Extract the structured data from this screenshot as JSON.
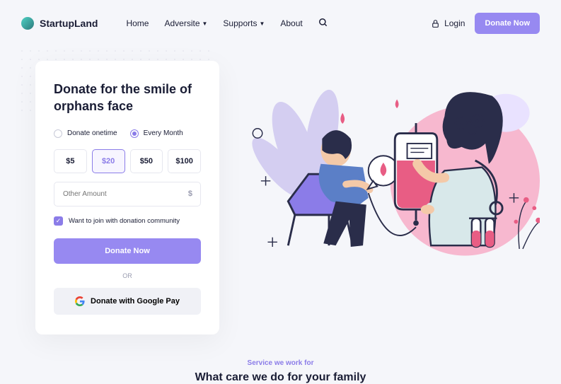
{
  "brand": "StartupLand",
  "nav": {
    "home": "Home",
    "adversite": "Adversite",
    "supports": "Supports",
    "about": "About"
  },
  "actions": {
    "login": "Login",
    "donate": "Donate Now"
  },
  "card": {
    "title": "Donate for the smile of orphans face",
    "freq_onetime": "Donate onetime",
    "freq_monthly": "Every Month",
    "amounts": [
      "$5",
      "$20",
      "$50",
      "$100"
    ],
    "other_placeholder": "Other Amount",
    "currency": "$",
    "community_label": "Want to join with donation community",
    "donate_btn": "Donate Now",
    "or": "OR",
    "gpay": "Donate with Google Pay"
  },
  "services": {
    "eyebrow": "Service we work for",
    "heading": "What care we do for your family"
  }
}
